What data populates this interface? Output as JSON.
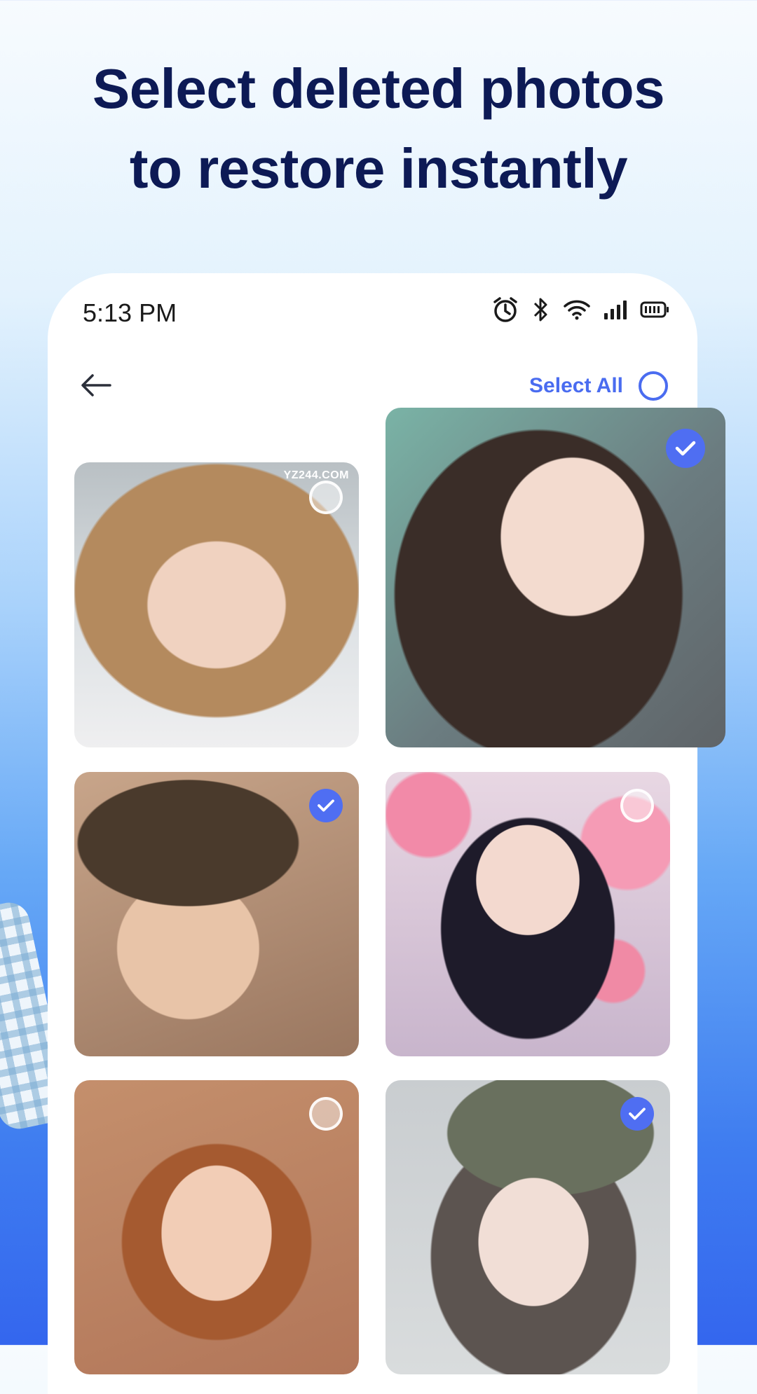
{
  "headline": {
    "line1": "Select deleted photos",
    "line2": "to restore instantly"
  },
  "status_bar": {
    "time": "5:13 PM",
    "icons": [
      "alarm-icon",
      "bluetooth-icon",
      "wifi-icon",
      "signal-icon",
      "battery-icon"
    ]
  },
  "toolbar": {
    "back_icon": "arrow-left-icon",
    "select_all_label": "Select All",
    "select_all_checked": false
  },
  "photos": [
    {
      "id": "photo-1",
      "selected": false,
      "watermark": "YZ244.COM"
    },
    {
      "id": "photo-2",
      "selected": true
    },
    {
      "id": "photo-3",
      "selected": true
    },
    {
      "id": "photo-4",
      "selected": false
    },
    {
      "id": "photo-5",
      "selected": false
    },
    {
      "id": "photo-6",
      "selected": true
    }
  ],
  "colors": {
    "accent": "#4f6ef2",
    "headline": "#0d1a55"
  }
}
